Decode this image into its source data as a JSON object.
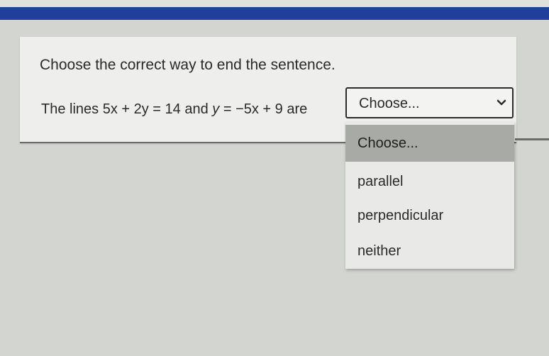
{
  "question": {
    "instruction": "Choose the correct way to end the sentence.",
    "sentence_prefix": "The lines 5x + 2y = 14 and ",
    "sentence_var": "y",
    "sentence_suffix": " = −5x + 9 are"
  },
  "select": {
    "value": "Choose...",
    "options": [
      "Choose...",
      "parallel",
      "perpendicular",
      "neither"
    ],
    "highlighted_index": 0
  },
  "colors": {
    "top_bar": "#1f3f9a",
    "highlight": "#a8aaa6"
  }
}
